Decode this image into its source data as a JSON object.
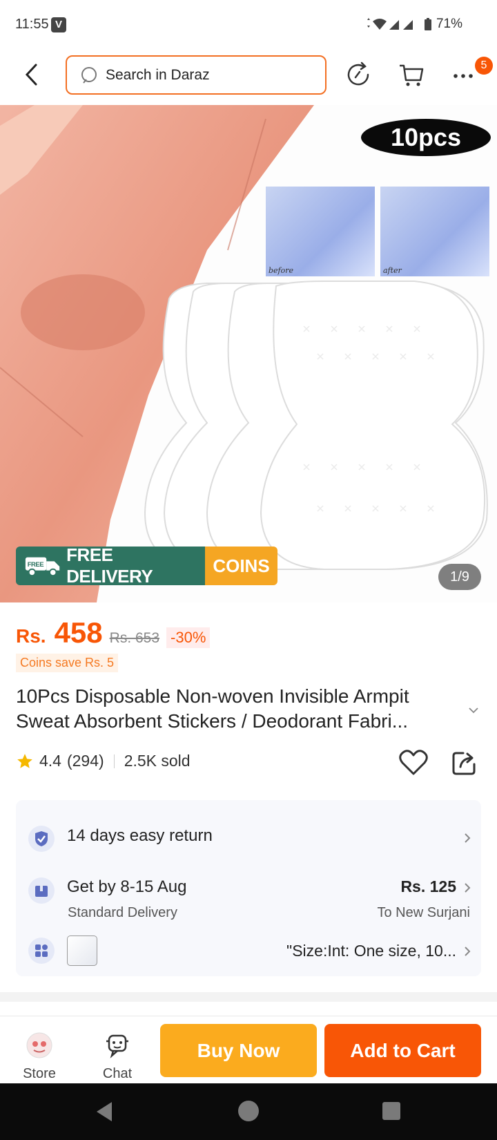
{
  "status": {
    "time": "11:55",
    "carrier_icon": "V",
    "battery": "71%"
  },
  "header": {
    "search_placeholder": "Search in Daraz",
    "cart_count": "5"
  },
  "hero": {
    "pack_label": "10pcs",
    "before_label": "before",
    "after_label": "after",
    "free_delivery": "FREE DELIVERY",
    "truck_tag": "FREE",
    "coins": "COINS",
    "pager": "1/9"
  },
  "price": {
    "currency": "Rs.",
    "current": "458",
    "original": "Rs. 653",
    "discount": "-30%",
    "coins_save": "Coins save Rs. 5"
  },
  "product": {
    "title": "10Pcs Disposable Non-woven Invisible Armpit Sweat Absorbent Stickers / Deodorant Fabri..."
  },
  "rating": {
    "score": "4.4",
    "count": "(294)",
    "sold": "2.5K sold"
  },
  "info": {
    "return": "14 days easy return",
    "delivery_date": "Get by 8-15 Aug",
    "delivery_type": "Standard Delivery",
    "delivery_fee": "Rs. 125",
    "delivery_to": "To New Surjani",
    "variant": "\"Size:Int: One size, 10..."
  },
  "bottom": {
    "store": "Store",
    "chat": "Chat",
    "buy_now": "Buy Now",
    "add_to_cart": "Add to Cart"
  },
  "colors": {
    "accent": "#f85606",
    "buy": "#fbab1e",
    "delivery_green": "#2e7461",
    "coins_yellow": "#f5a623"
  }
}
